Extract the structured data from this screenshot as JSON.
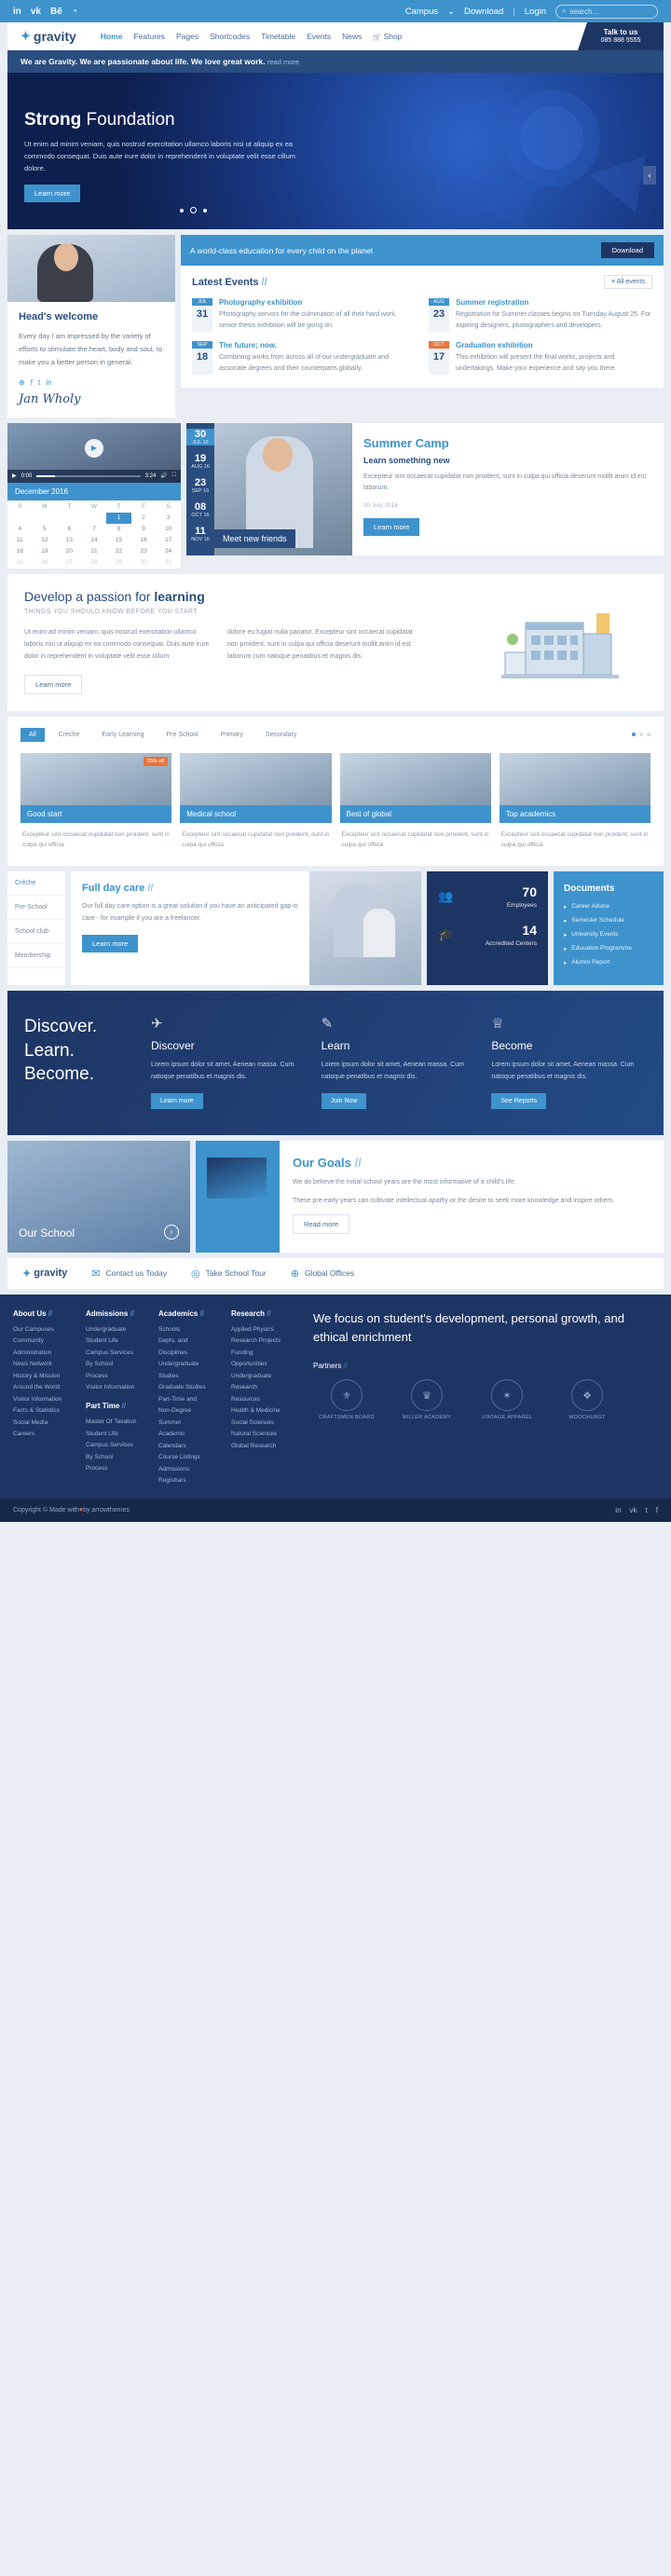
{
  "topbar": {
    "social": [
      "in",
      "vk",
      "Bē",
      "◔"
    ],
    "links": [
      "Campus",
      "Download",
      "Login"
    ],
    "campus_caret": "⌄",
    "separator": "|",
    "search_placeholder": "search...",
    "search_icon": "⌕"
  },
  "header": {
    "logo": "gravity",
    "logo_mark": "✦",
    "nav": [
      "Home",
      "Features",
      "Pages",
      "Shortcodes",
      "Timetable",
      "Events",
      "News",
      "Shop"
    ],
    "active_nav": "Home",
    "cart_icon": "🛒",
    "talk_title": "Talk to us",
    "talk_phone": "085 888 5555"
  },
  "notice": {
    "text": "We are Gravity. We are passionate about life. We love great work.",
    "link": "read more"
  },
  "hero": {
    "title_light": "Strong",
    "title_bold": "Foundation",
    "paragraph": "Ut enim ad minim veniam, quis nostrud exercitation ullamco laboris nisi ut aliquip ex ea commodo consequat. Duis aute irure dolor in reprehenderit in voluptate velit esse cillum dolore.",
    "button": "Learn more",
    "slide_count": 3,
    "active_slide": 2,
    "prev_icon": "‹",
    "next_icon": "›"
  },
  "welcome": {
    "title": "Head's welcome",
    "paragraph": "Every day I am impressed by the variety of efforts to stimulate the heart, body and soul, to make you a better person in general.",
    "social": [
      "⊕",
      "f",
      "t",
      "in"
    ],
    "signature": "Jan Wholy"
  },
  "ribbon": {
    "text": "A world-class education for every child on the planet",
    "button": "Download"
  },
  "events": {
    "title": "Latest Events",
    "title_slash": "//",
    "all_label": "All events",
    "all_icon": "≡",
    "items": [
      {
        "month": "JUL",
        "day": "31",
        "accent": "blue",
        "title": "Photography exhibition",
        "desc": "Photography servors for the culmination of all their hard work, senior thesis exhibition will be going on."
      },
      {
        "month": "AUG",
        "day": "23",
        "accent": "blue",
        "title": "Summer registration",
        "desc": "Registration for Summer classes begins on Tuesday August 25. For aspiring designers, photographers and developers."
      },
      {
        "month": "SEP",
        "day": "18",
        "accent": "blue",
        "title": "The future; now.",
        "desc": "Combining works from across all of our undergraduate and associate degrees and their counterparts globally."
      },
      {
        "month": "OCT",
        "day": "17",
        "accent": "orange",
        "title": "Graduation exhibition",
        "desc": "This exhibition will present the final works, projects and undertakings. Make your experience and say you there."
      }
    ]
  },
  "video": {
    "time_current": "0:00",
    "time_total": "3:24",
    "play_icon": "▶",
    "volume_icon": "🔊",
    "fullscreen_icon": "⛶"
  },
  "calendar": {
    "title": "December 2016",
    "weekdays": [
      "S",
      "M",
      "T",
      "W",
      "T",
      "F",
      "S"
    ],
    "weeks": [
      [
        "",
        "",
        "",
        "",
        "1",
        "2",
        "3"
      ],
      [
        "4",
        "5",
        "6",
        "7",
        "8",
        "9",
        "10"
      ],
      [
        "11",
        "12",
        "13",
        "14",
        "15",
        "16",
        "17"
      ],
      [
        "18",
        "19",
        "20",
        "21",
        "22",
        "23",
        "24"
      ],
      [
        "25",
        "26",
        "27",
        "28",
        "29",
        "30",
        "31"
      ]
    ],
    "selected": "1"
  },
  "camp": {
    "dates": [
      {
        "day": "30",
        "sub": "JUL 16",
        "active": true
      },
      {
        "day": "19",
        "sub": "AUG 16",
        "active": false
      },
      {
        "day": "23",
        "sub": "SEP 16",
        "active": false
      },
      {
        "day": "08",
        "sub": "OCT 16",
        "active": false
      },
      {
        "day": "11",
        "sub": "NOV 16",
        "active": false
      }
    ],
    "caption": "Meet new friends",
    "title": "Summer Camp",
    "subtitle": "Learn something new",
    "paragraph": "Excepteur sint occaecat cupidatat non proident, sunt in culpa qui officia deserunt mollit anim id est laborum.",
    "date": "30 July 2016",
    "button": "Learn more"
  },
  "passion": {
    "title_light": "Develop a passion for",
    "title_bold": "learning",
    "subtitle": "THINGS YOU SHOULD KNOW BEFORE YOU START",
    "col1": "Ut enim ad minim veniam, quis nostrud exercitation ullamco laboris nisi ut aliquip ex ea commodo consequat. Duis aute irure dolor in reprehenderit in voluptate velit esse cillum",
    "col2": "dolore eu fugiat nulla pariatur. Excepteur sint occaecat cupidatat non proident, sunt in culpa qui officia deserunt mollit anim id est laborum cum natoque penatibus et magnis dis.",
    "button": "Learn more"
  },
  "courses": {
    "filters": [
      "All",
      "Crèche",
      "Early Learning",
      "Pre School",
      "Primary",
      "Secondary"
    ],
    "active_filter": "All",
    "cards": [
      {
        "title": "Good start",
        "badge": "25% off",
        "desc": "Excepteur sint occaecat cupidatat non proident, sunt in culpa qui officia"
      },
      {
        "title": "Medical school",
        "badge": "",
        "desc": "Excepteur sint occaecat cupidatat non proident, sunt in culpa qui officia"
      },
      {
        "title": "Best of global",
        "badge": "",
        "desc": "Excepteur sint occaecat cupidatat non proident, sunt in culpa qui officia"
      },
      {
        "title": "Top academics",
        "badge": "",
        "desc": "Excepteur sint occaecat cupidatat non proident, sunt in culpa qui officia"
      }
    ]
  },
  "fullday": {
    "tabs": [
      "Crèche",
      "Pre-School",
      "School club",
      "Membership"
    ],
    "active_tab": "Crèche",
    "title": "Full day care",
    "title_slash": "//",
    "paragraph": "Our full day care option is a great solution if you have an anticipated gap in care - for example if you are a freelancer.",
    "button": "Learn more",
    "stats": [
      {
        "icon": "👥",
        "number": "70",
        "label": "Employees"
      },
      {
        "icon": "🎓",
        "number": "14",
        "label": "Accredited Centers"
      }
    ],
    "docs_title": "Documents",
    "docs": [
      "Career Advice",
      "Semester Schedule",
      "University Events",
      "Education Programme",
      "Alumni Report"
    ],
    "doc_icon": "▸"
  },
  "discover": {
    "heading_lines": [
      "Discover.",
      "Learn.",
      "Become."
    ],
    "columns": [
      {
        "icon": "✈",
        "title": "Discover",
        "text": "Lorem ipsum dolor sit amet, Aenean massa. Cum natoque penatibus et magnis dis.",
        "button": "Learn more"
      },
      {
        "icon": "✎",
        "title": "Learn",
        "text": "Lorem ipsum dolor sit amet, Aenean massa. Cum natoque penatibus et magnis dis.",
        "button": "Join Now"
      },
      {
        "icon": "♕",
        "title": "Become",
        "text": "Lorem ipsum dolor sit amet, Aenean massa. Cum natoque penatibus et magnis dis.",
        "button": "See Reports"
      }
    ]
  },
  "school": {
    "label": "Our School",
    "arrow": "›"
  },
  "goals": {
    "title": "Our Goals",
    "title_slash": "//",
    "p1": "We do believe the initial school years are the most informative of a child's life.",
    "p2": "These pre-early years can cultivate intellectual apathy or the desire to seek more knowledge and inspire others.",
    "button": "Read more"
  },
  "ctabar": {
    "logo": "gravity",
    "logo_mark": "✦",
    "items": [
      {
        "icon": "✉",
        "label": "Contact us Today"
      },
      {
        "icon": "◎",
        "label": "Take School Tour"
      },
      {
        "icon": "⊕",
        "label": "Global Offices"
      }
    ]
  },
  "footer": {
    "columns": [
      {
        "heading": "About Us",
        "slash": "//",
        "links": [
          "Our Campuses",
          "Community",
          "Administration",
          "News Network",
          "History & Mission",
          "Around the World",
          "Visitor Information",
          "Facts & Statistics",
          "Social Media",
          "Careers"
        ]
      },
      {
        "heading": "Admissions",
        "slash": "//",
        "links": [
          "Undergraduate",
          "Student Life",
          "Campus Services",
          "By School",
          "Process",
          "Visitor Information"
        ],
        "heading2": "Part Time",
        "slash2": "//",
        "links2": [
          "Master Of Taxation",
          "Student Life",
          "Campus Services",
          "By School",
          "Process"
        ]
      },
      {
        "heading": "Academics",
        "slash": "//",
        "links": [
          "Schools",
          "Depts. and",
          "Disciplines",
          "Undergraduate",
          "Studies",
          "Graduate Studies",
          "Part-Time and",
          "Non-Degree",
          "Summer",
          "Academic",
          "Calendars",
          "Course Listings",
          "Admissions",
          "Registrars"
        ]
      },
      {
        "heading": "Research",
        "slash": "//",
        "links": [
          "Applied Physics",
          "Research Projects",
          "Funding",
          "Opportunities",
          "Undergraduate",
          "Research",
          "Resources",
          "Health & Medicine",
          "Social Sciences",
          "Natural Sciences",
          "Global Research"
        ]
      }
    ],
    "tagline": "We focus on student's development, personal growth, and ethical enrichment",
    "partners_label": "Partners",
    "partners_slash": "//",
    "partners": [
      {
        "mark": "⚜",
        "name": "CRAFTSMEN BOARD"
      },
      {
        "mark": "♛",
        "name": "MILLER ACADEMY"
      },
      {
        "mark": "✶",
        "name": "VINTAGE APPAREL"
      },
      {
        "mark": "❖",
        "name": "WOODHURST"
      }
    ]
  },
  "copyright": {
    "text_pre": "Copyright © Made with ",
    "heart": "♥",
    "text_post": " by arrowthemes",
    "social": [
      "in",
      "vk",
      "t",
      "f"
    ]
  }
}
